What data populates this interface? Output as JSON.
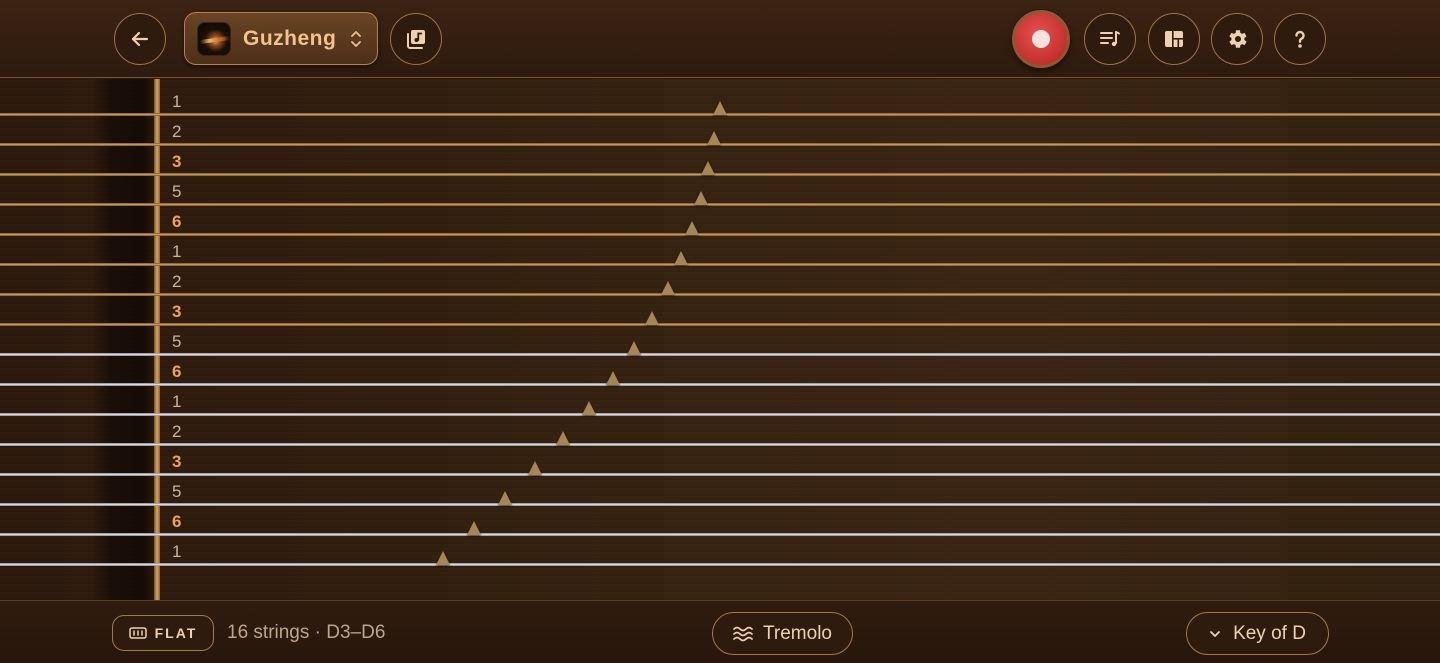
{
  "header": {
    "instrument_name": "Guzheng"
  },
  "icons": {
    "back": "arrow-left-icon",
    "picker": "chevron-up-down-icon",
    "library": "music-library-icon",
    "record": "record-icon",
    "playlist": "playlist-icon",
    "layout": "layout-icon",
    "settings": "gear-icon",
    "help": "question-icon",
    "keyboard": "keyboard-icon",
    "tremolo": "waves-icon",
    "key": "chevron-down-icon"
  },
  "strings": [
    {
      "note": "1",
      "accent": false,
      "color": "gold",
      "bridge": 0.0
    },
    {
      "note": "2",
      "accent": false,
      "color": "gold",
      "bridge": 0.0
    },
    {
      "note": "3",
      "accent": true,
      "color": "gold",
      "bridge": 0.0
    },
    {
      "note": "5",
      "accent": false,
      "color": "gold",
      "bridge": 0.0
    },
    {
      "note": "6",
      "accent": true,
      "color": "gold",
      "bridge": 0.0
    },
    {
      "note": "1",
      "accent": false,
      "color": "gold",
      "bridge": 0.0
    },
    {
      "note": "2",
      "accent": false,
      "color": "gold",
      "bridge": 0.0
    },
    {
      "note": "3",
      "accent": true,
      "color": "gold",
      "bridge": 0.0
    },
    {
      "note": "5",
      "accent": false,
      "color": "silver",
      "bridge": 0.0
    },
    {
      "note": "6",
      "accent": true,
      "color": "silver",
      "bridge": 0.0
    },
    {
      "note": "1",
      "accent": false,
      "color": "silver",
      "bridge": 0.0
    },
    {
      "note": "2",
      "accent": false,
      "color": "silver",
      "bridge": 0.0
    },
    {
      "note": "3",
      "accent": true,
      "color": "silver",
      "bridge": 0.0
    },
    {
      "note": "5",
      "accent": false,
      "color": "silver",
      "bridge": 0.0
    },
    {
      "note": "6",
      "accent": true,
      "color": "silver",
      "bridge": 0.0
    },
    {
      "note": "1",
      "accent": false,
      "color": "silver",
      "bridge": 0.0
    }
  ],
  "footer": {
    "flat_label": "FLAT",
    "strings_info": "16 strings · D3–D6",
    "tremolo_label": "Tremolo",
    "key_label": "Key of D"
  },
  "colors": {
    "accent_note": "#f0a258",
    "record": "#c2302d",
    "gold_string": "#caa064",
    "silver_string": "#e6e6ea"
  }
}
